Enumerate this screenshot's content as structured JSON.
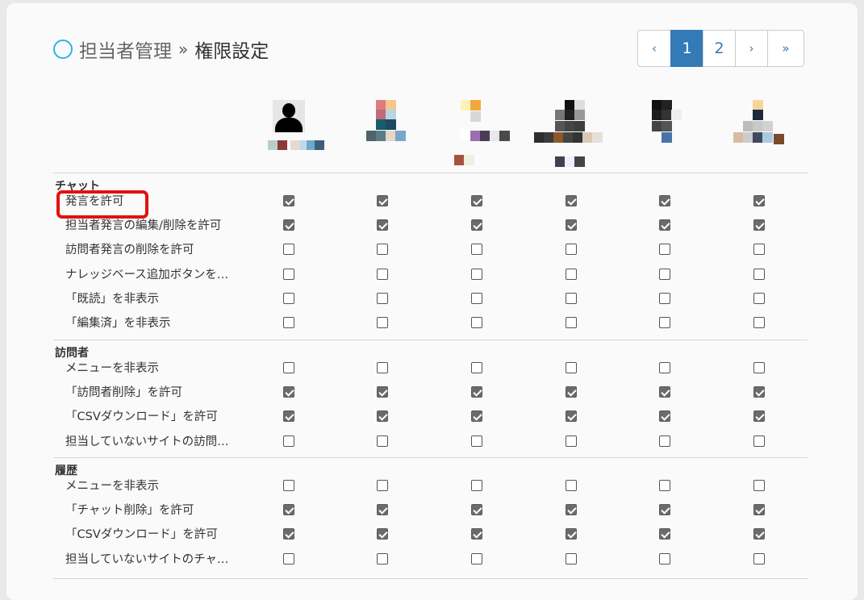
{
  "header": {
    "crumb": "担当者管理",
    "separator": "»",
    "current": "権限設定"
  },
  "pagination": {
    "prev": "‹",
    "pages": [
      "1",
      "2"
    ],
    "active": "1",
    "next": "›",
    "last": "»"
  },
  "colors": {
    "accent_ring": "#2ab6e6",
    "pager_active": "#337ab7",
    "highlight": "#e0120f",
    "checkbox_checked": "#6b6b6b"
  },
  "users": [
    {
      "avatar": "default-person-avatar"
    },
    {
      "avatar": "pixelated-avatar"
    },
    {
      "avatar": "pixelated-avatar"
    },
    {
      "avatar": "pixelated-avatar"
    },
    {
      "avatar": "pixelated-avatar"
    },
    {
      "avatar": "pixelated-avatar"
    }
  ],
  "sections": [
    {
      "label": "チャット",
      "rows": [
        {
          "label": "発言を許可",
          "values": [
            true,
            true,
            true,
            true,
            true,
            true
          ]
        },
        {
          "label": "担当者発言の編集/削除を許可",
          "values": [
            true,
            true,
            true,
            true,
            true,
            true
          ]
        },
        {
          "label": "訪問者発言の削除を許可",
          "values": [
            false,
            false,
            false,
            false,
            false,
            false
          ]
        },
        {
          "label": "ナレッジベース追加ボタンを…",
          "values": [
            false,
            false,
            false,
            false,
            false,
            false
          ]
        },
        {
          "label": "「既読」を非表示",
          "values": [
            false,
            false,
            false,
            false,
            false,
            false
          ]
        },
        {
          "label": "「編集済」を非表示",
          "values": [
            false,
            false,
            false,
            false,
            false,
            false
          ]
        }
      ]
    },
    {
      "label": "訪問者",
      "rows": [
        {
          "label": "メニューを非表示",
          "values": [
            false,
            false,
            false,
            false,
            false,
            false
          ]
        },
        {
          "label": "「訪問者削除」を許可",
          "values": [
            true,
            true,
            true,
            true,
            true,
            true
          ]
        },
        {
          "label": "「CSVダウンロード」を許可",
          "values": [
            true,
            true,
            true,
            true,
            true,
            true
          ]
        },
        {
          "label": "担当していないサイトの訪問…",
          "values": [
            false,
            false,
            false,
            false,
            false,
            false
          ]
        }
      ]
    },
    {
      "label": "履歴",
      "rows": [
        {
          "label": "メニューを非表示",
          "values": [
            false,
            false,
            false,
            false,
            false,
            false
          ]
        },
        {
          "label": "「チャット削除」を許可",
          "values": [
            true,
            true,
            true,
            true,
            true,
            true
          ]
        },
        {
          "label": "「CSVダウンロード」を許可",
          "values": [
            true,
            true,
            true,
            true,
            true,
            true
          ]
        },
        {
          "label": "担当していないサイトのチャ…",
          "values": [
            false,
            false,
            false,
            false,
            false,
            false
          ]
        }
      ]
    }
  ]
}
